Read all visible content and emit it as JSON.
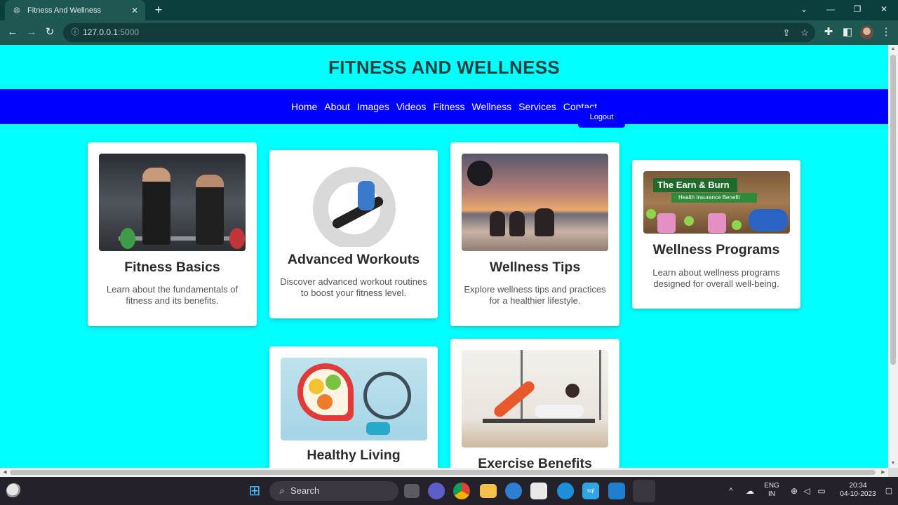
{
  "browser": {
    "tab_title": "Fitness And Wellness",
    "url_host": "127.0.0.1",
    "url_port": ":5000"
  },
  "site": {
    "title": "FITNESS AND WELLNESS",
    "nav": [
      "Home",
      "About",
      "Images",
      "Videos",
      "Fitness",
      "Wellness",
      "Services",
      "Contact"
    ],
    "logout": "Logout"
  },
  "cards": [
    {
      "title": "Fitness Basics",
      "text": "Learn about the fundamentals of fitness and its benefits."
    },
    {
      "title": "Advanced Workouts",
      "text": "Discover advanced workout routines to boost your fitness level."
    },
    {
      "title": "Wellness Tips",
      "text": "Explore wellness tips and practices for a healthier lifestyle."
    },
    {
      "title": "Wellness Programs",
      "text": "Learn about wellness programs designed for overall well-being.",
      "image_text": {
        "banner": "The Earn & Burn",
        "sub": "Health Insurance Benefit"
      }
    },
    {
      "title": "Healthy Living",
      "text": ""
    },
    {
      "title": "Exercise Benefits",
      "text": ""
    }
  ],
  "taskbar": {
    "search": "Search",
    "lang_top": "ENG",
    "lang_bottom": "IN",
    "time": "20:34",
    "date": "04-10-2023"
  },
  "colors": {
    "page_bg": "#00ffff",
    "nav_bg": "#0000ff",
    "title_color": "#1f3f3f"
  }
}
